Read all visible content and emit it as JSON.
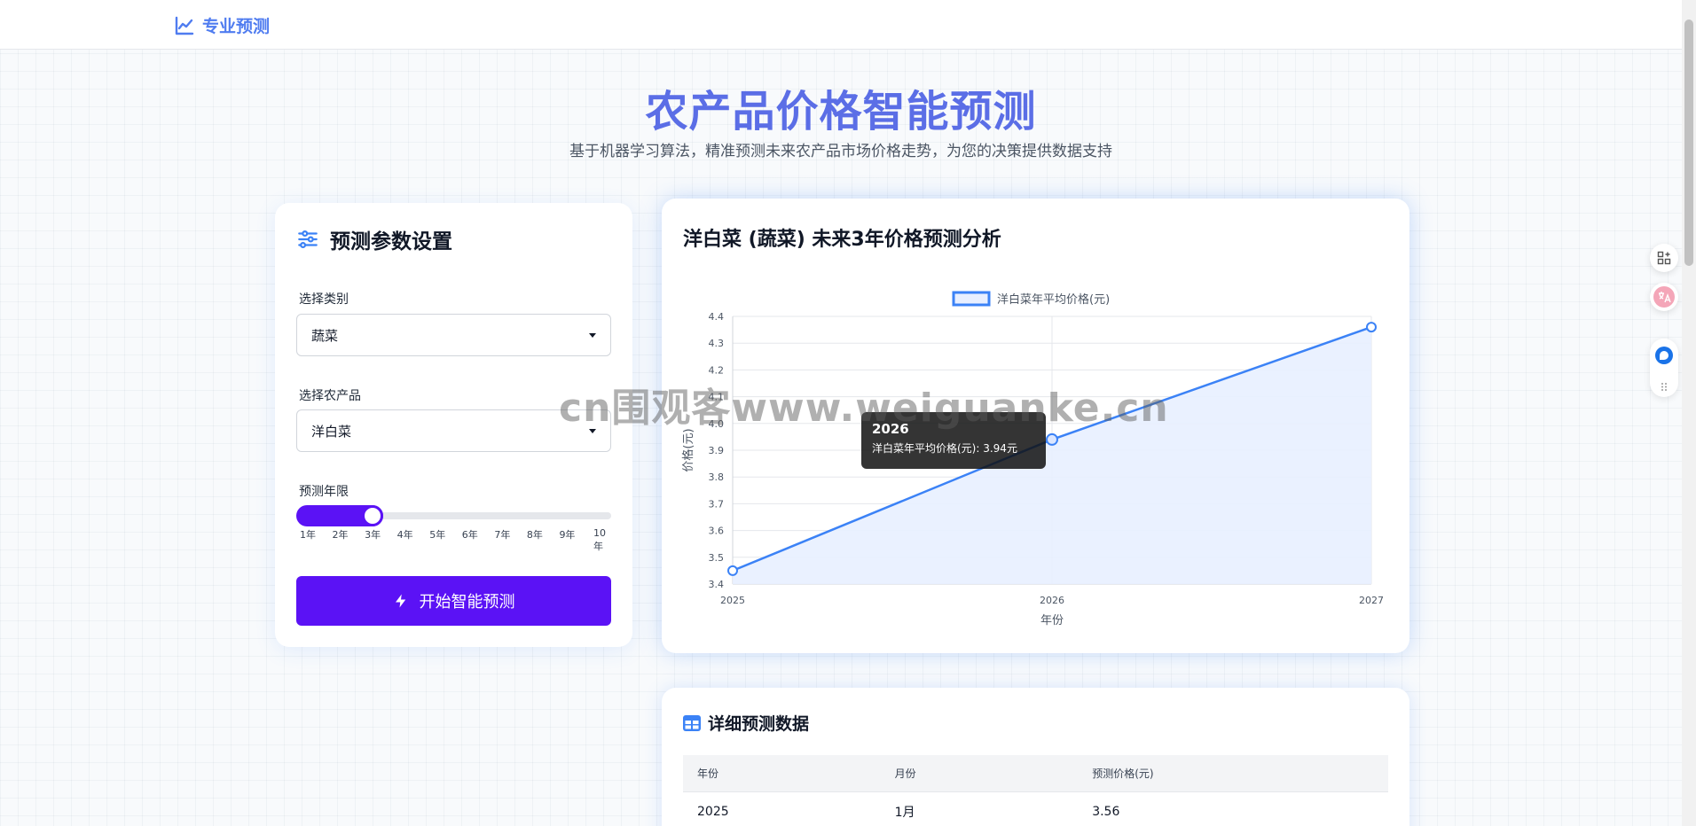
{
  "nav": {
    "brand_label": "专业预测",
    "brand_icon": "trend-chart-icon"
  },
  "hero": {
    "title": "农产品价格智能预测",
    "subtitle": "基于机器学习算法，精准预测未来农产品市场价格走势，为您的决策提供数据支持"
  },
  "params": {
    "heading": "预测参数设置",
    "category_label": "选择类别",
    "category_value": "蔬菜",
    "product_label": "选择农产品",
    "product_value": "洋白菜",
    "years_label": "预测年限",
    "years_value": 3,
    "years_max": 10,
    "ticks": [
      "1年",
      "2年",
      "3年",
      "4年",
      "5年",
      "6年",
      "7年",
      "8年",
      "9年",
      "10年"
    ],
    "submit_label": "开始智能预测"
  },
  "chart_card": {
    "title": "洋白菜 (蔬菜) 未来3年价格预测分析"
  },
  "chart_data": {
    "type": "line",
    "x": [
      "2025",
      "2026",
      "2027"
    ],
    "series": [
      {
        "name": "洋白菜年平均价格(元)",
        "values": [
          3.45,
          3.94,
          4.36
        ]
      }
    ],
    "xlabel": "年份",
    "ylabel": "价格(元)",
    "ylim": [
      3.4,
      4.4
    ],
    "yticks": [
      "3.4",
      "3.5",
      "3.6",
      "3.7",
      "3.8",
      "3.9",
      "4.0",
      "4.1",
      "4.2",
      "4.3",
      "4.4"
    ],
    "grid": true,
    "legend": "top",
    "color": "#3b82f6",
    "fill": "#e8efff",
    "tooltip": {
      "title": "2026",
      "body": "洋白菜年平均价格(元): 3.94元"
    }
  },
  "table": {
    "heading": "详细预测数据",
    "columns": [
      "年份",
      "月份",
      "预测价格(元)"
    ],
    "rows": [
      [
        "2025",
        "1月",
        "3.56"
      ]
    ]
  },
  "watermark": "cn围观客www.weiguanke.cn"
}
